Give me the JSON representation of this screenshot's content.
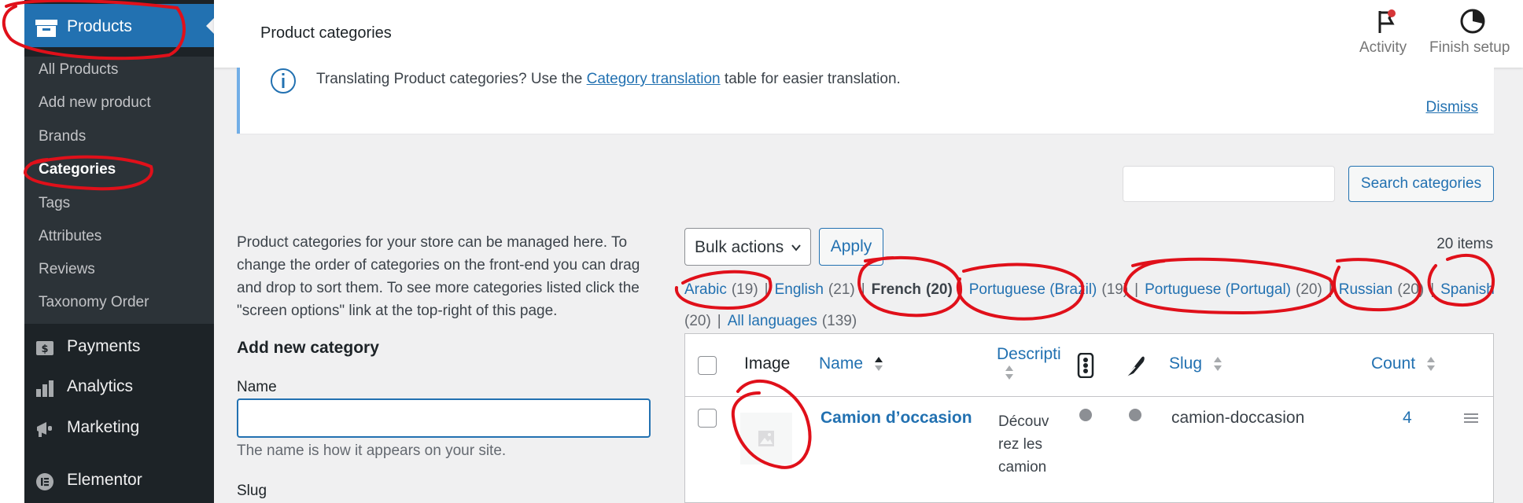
{
  "sidebar": {
    "top_item": {
      "label": "Products",
      "icon": "archive-icon"
    },
    "submenu": [
      {
        "label": "All Products"
      },
      {
        "label": "Add new product"
      },
      {
        "label": "Brands"
      },
      {
        "label": "Categories",
        "current": true
      },
      {
        "label": "Tags"
      },
      {
        "label": "Attributes"
      },
      {
        "label": "Reviews"
      },
      {
        "label": "Taxonomy Order"
      }
    ],
    "menu": [
      {
        "label": "Payments",
        "icon": "payments-icon"
      },
      {
        "label": "Analytics",
        "icon": "analytics-icon"
      },
      {
        "label": "Marketing",
        "icon": "megaphone-icon"
      },
      {
        "label": "Elementor",
        "icon": "elementor-icon"
      }
    ]
  },
  "header": {
    "title": "Product categories",
    "activity_label": "Activity",
    "finish_label": "Finish setup"
  },
  "notice": {
    "text_before": "Translating Product categories? Use the ",
    "link": "Category translation",
    "text_after": " table for easier translation.",
    "dismiss": "Dismiss"
  },
  "search": {
    "button": "Search categories",
    "value": ""
  },
  "left": {
    "description": "Product categories for your store can be managed here. To change the order of categories on the front-end you can drag and drop to sort them. To see more categories listed click the \"screen options\" link at the top-right of this page.",
    "heading": "Add new category",
    "name_label": "Name",
    "name_help": "The name is how it appears on your site.",
    "slug_label": "Slug"
  },
  "table_controls": {
    "bulk_actions": "Bulk actions",
    "apply": "Apply",
    "items_count": "20 items"
  },
  "languages": {
    "row1": [
      {
        "label": "Arabic",
        "count": "(19)"
      },
      {
        "label": "English",
        "count": "(21)"
      },
      {
        "label": "French",
        "count": "(20)",
        "current": true
      },
      {
        "label": "Portuguese (Brazil)",
        "count": "(19)"
      },
      {
        "label": "Portuguese (Portugal)",
        "count": "(20)"
      },
      {
        "label": "Russian",
        "count": "(20)"
      },
      {
        "label": "Spanish",
        "count": ""
      }
    ],
    "row2_lead": "(20)",
    "all_label": "All languages",
    "all_count": "(139)"
  },
  "table": {
    "columns": {
      "image": "Image",
      "name": "Name",
      "description": "Descripti",
      "slug": "Slug",
      "count": "Count"
    },
    "rows": [
      {
        "name": "Camion d’occasion",
        "description": "Découvrez les camion",
        "slug": "camion-doccasion",
        "count": "4"
      }
    ]
  },
  "colors": {
    "sidebar_bg": "#1d2327",
    "submenu_bg": "#2c3338",
    "accent": "#2271b1",
    "annotation": "#e0101a"
  }
}
